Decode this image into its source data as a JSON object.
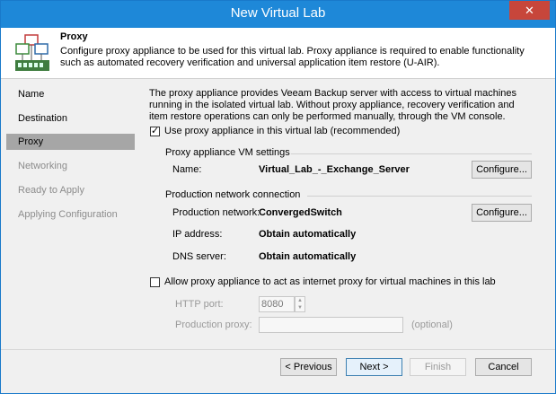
{
  "window": {
    "title": "New Virtual Lab",
    "close_glyph": "✕"
  },
  "header": {
    "title": "Proxy",
    "description": "Configure proxy appliance to be used for this virtual lab. Proxy appliance is required to enable functionality such as automated recovery verification and universal application item restore (U-AIR).",
    "icon": "virtual-lab-network-icon"
  },
  "sidebar": {
    "steps": [
      {
        "label": "Name",
        "state": "done"
      },
      {
        "label": "Destination",
        "state": "done"
      },
      {
        "label": "Proxy",
        "state": "active"
      },
      {
        "label": "Networking",
        "state": "disabled"
      },
      {
        "label": "Ready to Apply",
        "state": "disabled"
      },
      {
        "label": "Applying Configuration",
        "state": "disabled"
      }
    ]
  },
  "main": {
    "intro": "The proxy appliance provides Veeam Backup server with access to virtual machines running in the isolated virtual lab. Without proxy appliance, recovery verification and item restore operations can only be performed manually, through the VM console.",
    "use_proxy": {
      "label": "Use proxy appliance in this virtual lab (recommended)",
      "checked": true
    },
    "vm_settings": {
      "group_label": "Proxy appliance VM settings",
      "name_label": "Name:",
      "name_value": "Virtual_Lab_-_Exchange_Server",
      "configure_label": "Configure..."
    },
    "production": {
      "group_label": "Production network connection",
      "network_label": "Production network:",
      "network_value": "ConvergedSwitch",
      "configure_label": "Configure...",
      "ip_label": "IP address:",
      "ip_value": "Obtain automatically",
      "dns_label": "DNS server:",
      "dns_value": "Obtain automatically"
    },
    "internet_proxy": {
      "label": "Allow proxy appliance to act as internet proxy for virtual machines in this lab",
      "checked": false,
      "http_port_label": "HTTP port:",
      "http_port_value": "8080",
      "production_proxy_label": "Production proxy:",
      "production_proxy_value": "",
      "optional_label": "(optional)"
    }
  },
  "footer": {
    "previous": "< Previous",
    "next": "Next >",
    "finish": "Finish",
    "cancel": "Cancel"
  },
  "colors": {
    "titlebar": "#1e88d8",
    "close": "#c7463b",
    "active_step": "#a6a6a6"
  }
}
